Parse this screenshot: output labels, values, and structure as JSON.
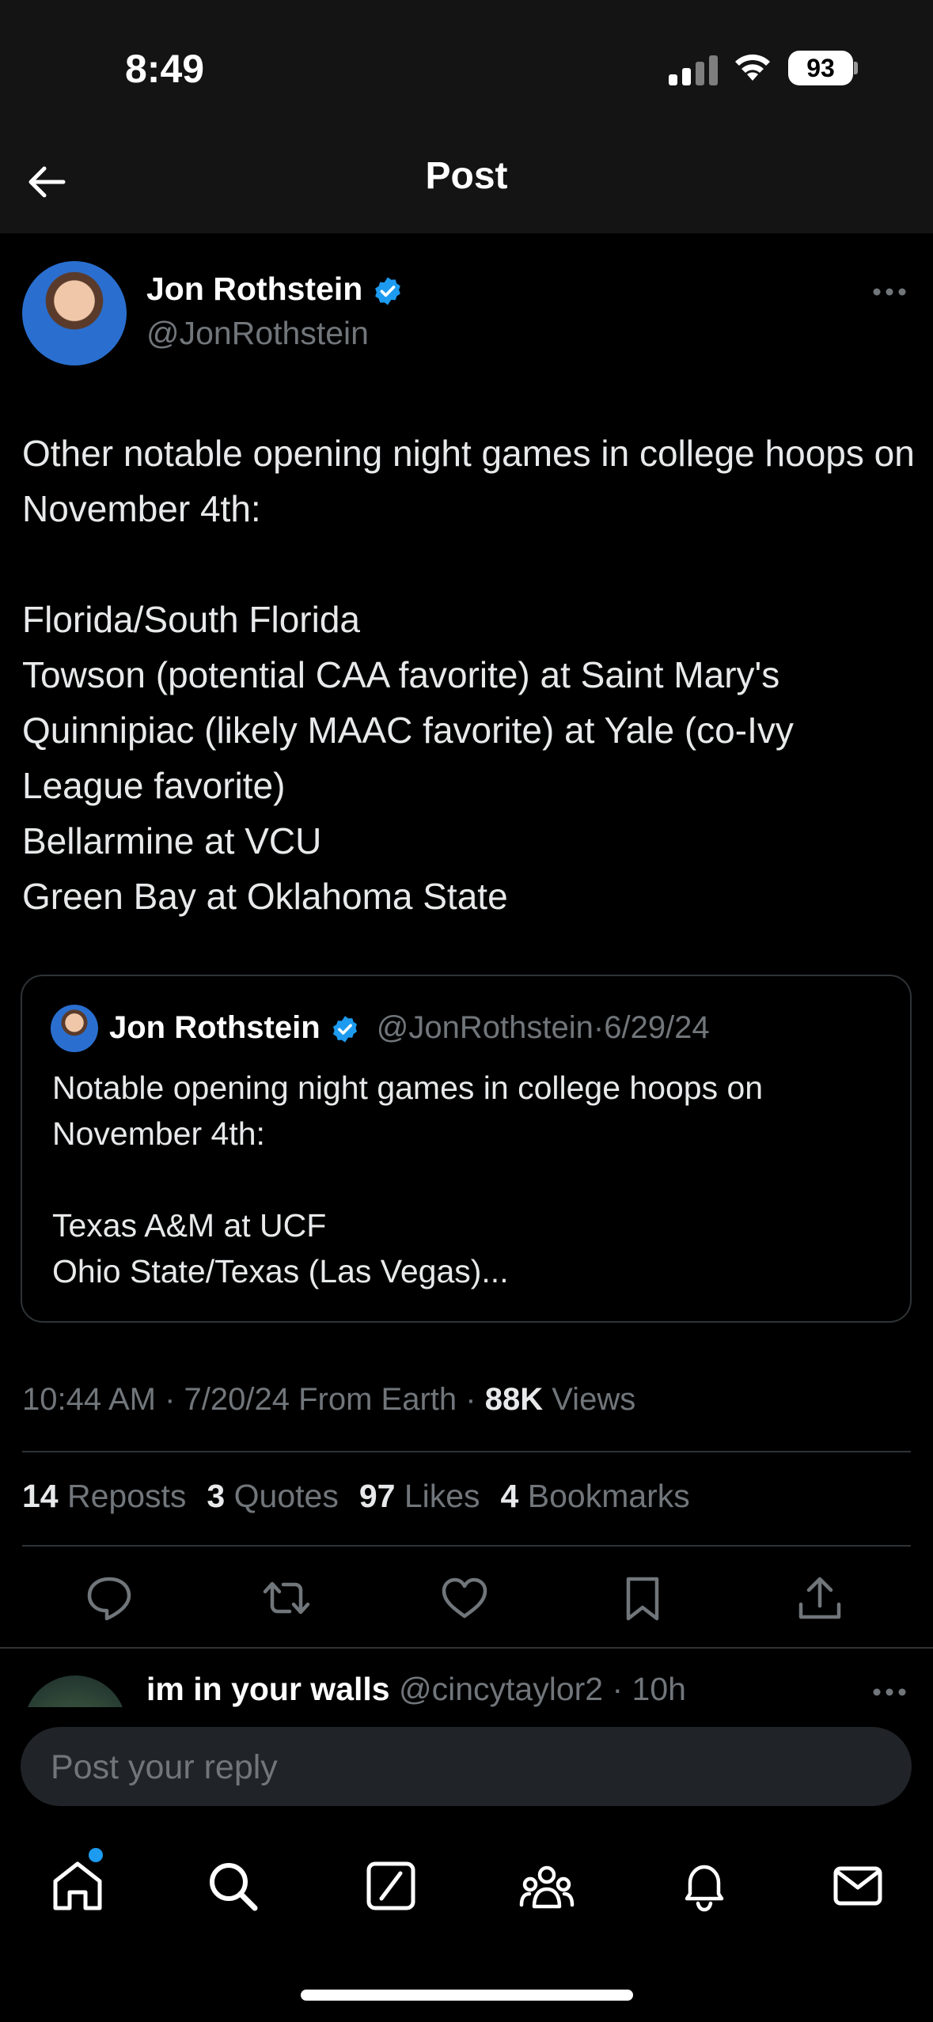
{
  "status_bar": {
    "time": "8:49",
    "battery": "93"
  },
  "header": {
    "title": "Post"
  },
  "post": {
    "author_name": "Jon Rothstein",
    "author_handle": "@JonRothstein",
    "text": "Other notable opening night games in college hoops on November 4th:\n\nFlorida/South Florida\nTowson (potential CAA favorite) at Saint Mary's\nQuinnipiac (likely MAAC favorite) at Yale (co-Ivy League favorite)\nBellarmine at VCU\nGreen Bay at Oklahoma State"
  },
  "quote": {
    "author_name": "Jon Rothstein",
    "author_handle": "@JonRothstein",
    "date": "6/29/24",
    "separator": "·",
    "text": "Notable opening night games in college hoops on November 4th:\n\nTexas A&M at UCF\nOhio State/Texas (Las Vegas)..."
  },
  "meta": {
    "timestamp": "10:44 AM · 7/20/24 From Earth · ",
    "views_count": "88K",
    "views_label": " Views"
  },
  "stats": {
    "reposts_count": "14",
    "reposts_label": " Reposts",
    "quotes_count": "3",
    "quotes_label": " Quotes",
    "likes_count": "97",
    "likes_label": " Likes",
    "bookmarks_count": "4",
    "bookmarks_label": " Bookmarks"
  },
  "reply_preview": {
    "name": "im in your walls",
    "meta": " @cincytaylor2 · 10h"
  },
  "reply_box": {
    "placeholder": "Post your reply"
  },
  "colors": {
    "accent": "#1d9bf0",
    "muted": "#71767b",
    "divider": "#2f3336"
  },
  "icons": [
    "back-arrow-icon",
    "verified-badge-icon",
    "more-icon",
    "reply-icon",
    "repost-icon",
    "like-icon",
    "bookmark-icon",
    "share-icon",
    "home-icon",
    "search-icon",
    "grok-icon",
    "communities-icon",
    "notifications-icon",
    "messages-icon"
  ]
}
